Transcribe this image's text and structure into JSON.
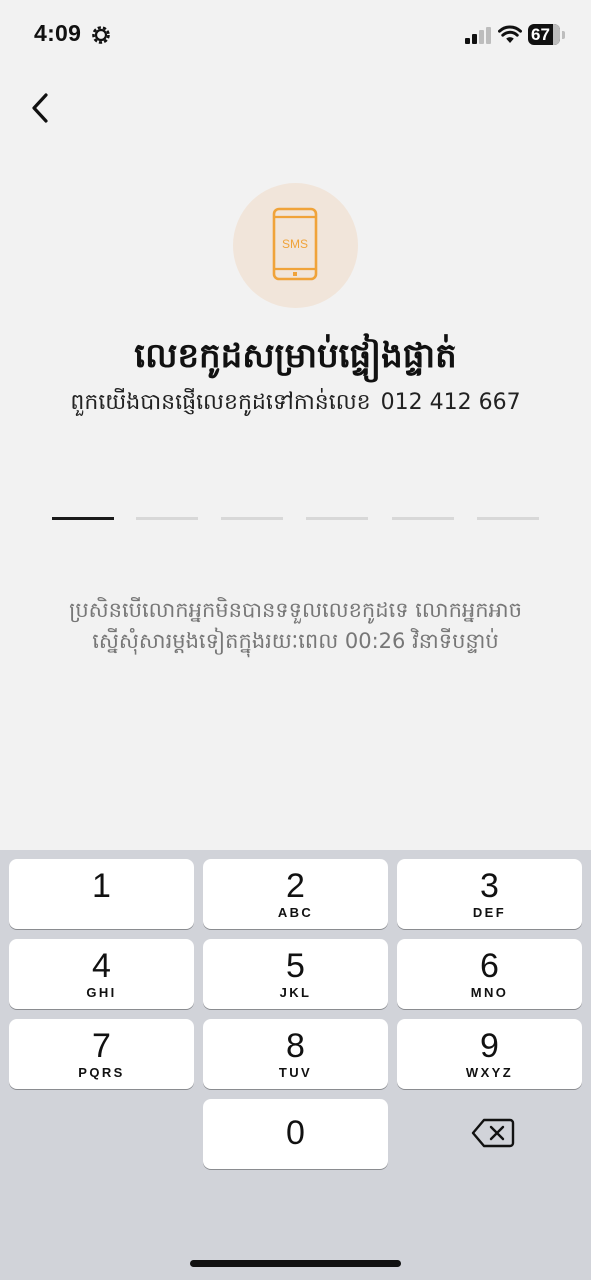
{
  "status_bar": {
    "time": "4:09",
    "battery": "67",
    "icons": [
      "gear-icon",
      "signal-icon",
      "wifi-icon",
      "battery-icon"
    ]
  },
  "nav": {
    "back_icon": "chevron-left-icon"
  },
  "hero": {
    "icon": "sms-phone-icon",
    "icon_text": "SMS",
    "accent_color": "#f0a33a"
  },
  "title": "លេខកូដសម្រាប់ផ្ទៀងផ្ទាត់",
  "subtitle": {
    "text": "ពួកយើងបានផ្ញើលេខកូដទៅកាន់លេខ",
    "phone": "012 412 667"
  },
  "otp": {
    "length": 6,
    "active_index": 0,
    "entered": ""
  },
  "resend": {
    "line1": "ប្រសិនបើលោកអ្នកមិនបានទទួលលេខកូដទេ លោកអ្នកអាច",
    "line2": "ស្នើសុំសារម្តងទៀតក្នុងរយៈពេល 00:26 វិនាទីបន្ទាប់"
  },
  "keypad": {
    "keys": [
      {
        "num": "1",
        "letters": ""
      },
      {
        "num": "2",
        "letters": "ABC"
      },
      {
        "num": "3",
        "letters": "DEF"
      },
      {
        "num": "4",
        "letters": "GHI"
      },
      {
        "num": "5",
        "letters": "JKL"
      },
      {
        "num": "6",
        "letters": "MNO"
      },
      {
        "num": "7",
        "letters": "PQRS"
      },
      {
        "num": "8",
        "letters": "TUV"
      },
      {
        "num": "9",
        "letters": "WXYZ"
      },
      {
        "num": "0",
        "letters": ""
      }
    ],
    "delete_icon": "backspace-icon"
  }
}
